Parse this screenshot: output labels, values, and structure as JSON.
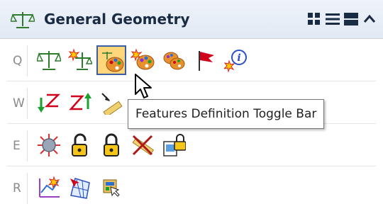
{
  "titlebar": {
    "title": "General Geometry",
    "icon": "balance-geometry-icon",
    "controls": [
      "grid-view-icon",
      "list-view-icon",
      "panel-view-icon",
      "collapse-chevron-icon"
    ]
  },
  "rows": [
    {
      "key": "Q",
      "tools": [
        "balance-scale-icon",
        "balance-scale-starburst-icon",
        "feature-palette-toggle-icon",
        "palette-starburst-icon",
        "palette-pair-icon",
        "red-flag-icon",
        "info-starburst-icon"
      ]
    },
    {
      "key": "W",
      "tools": [
        "zigzag-down-arrow-icon",
        "zigzag-up-arrow-icon",
        "ruler-arrow-icon"
      ]
    },
    {
      "key": "E",
      "tools": [
        "target-starburst-icon",
        "padlock-open-icon",
        "padlock-closed-icon",
        "ruler-cross-icon",
        "document-lock-icon"
      ]
    },
    {
      "key": "R",
      "tools": [
        "graph-select-icon",
        "mesh-cursor-icon",
        "window-select-icon"
      ]
    }
  ],
  "selected_tool": "feature-palette-toggle-icon",
  "tooltip": {
    "text": "Features Definition Toggle Bar"
  },
  "colors": {
    "title_text": "#1a2b44",
    "selection_fill": "#ffd67a",
    "selection_border": "#3a5fa8",
    "key_text": "#8a8a8a",
    "flag_red": "#d0021b",
    "arrow_green": "#1aa12b"
  }
}
